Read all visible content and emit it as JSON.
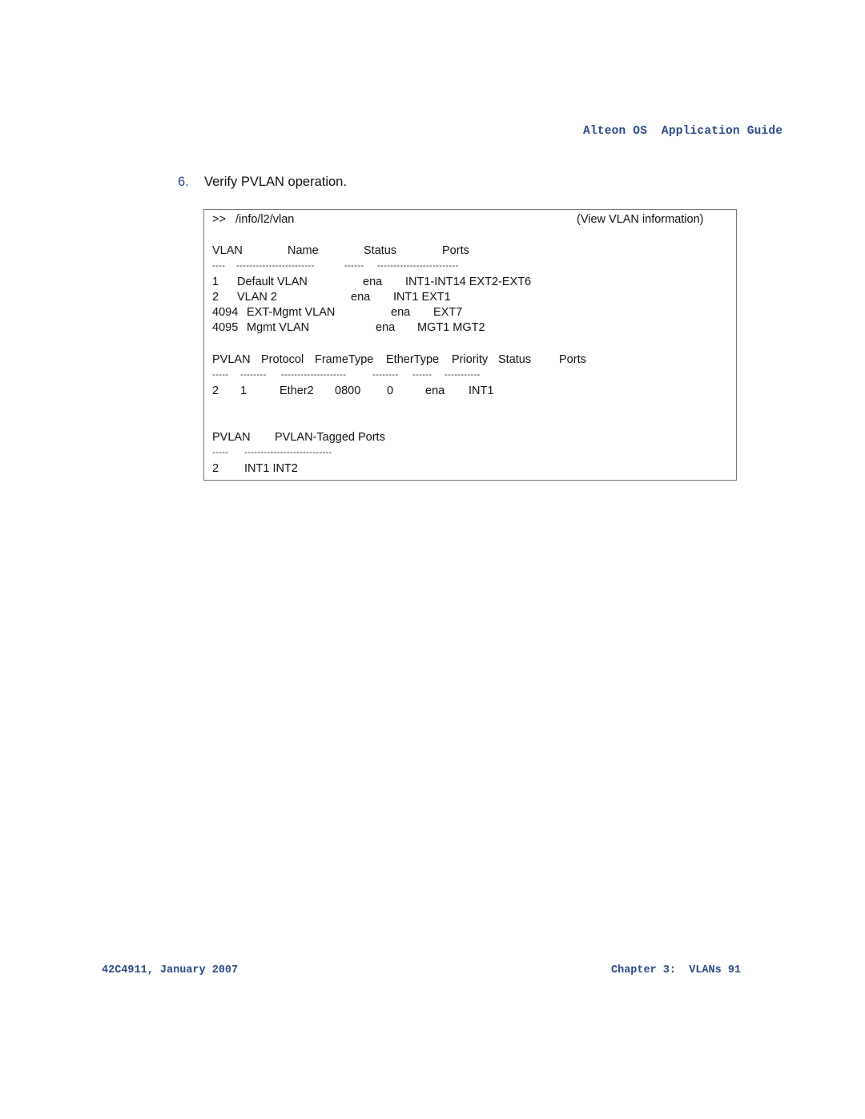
{
  "header": {
    "title": "Alteon OS  Application Guide"
  },
  "step": {
    "number": "6.",
    "text": "Verify PVLAN operation."
  },
  "command_box": {
    "prompt": ">>",
    "command": "/info/l2/vlan",
    "comment": "(View VLAN information)",
    "vlan_table": {
      "headers": [
        "VLAN",
        "Name",
        "Status",
        "Ports"
      ],
      "separator": [
        "----",
        "------------------------",
        "------",
        "-------------------------"
      ],
      "rows": [
        {
          "vlan": "1",
          "name": "Default VLAN",
          "status": "ena",
          "ports": "INT1-INT14 EXT2-EXT6"
        },
        {
          "vlan": "2",
          "name": "VLAN 2",
          "status": "ena",
          "ports": "INT1 EXT1"
        },
        {
          "vlan": "4094",
          "name": "EXT-Mgmt VLAN",
          "status": "ena",
          "ports": "EXT7"
        },
        {
          "vlan": "4095",
          "name": "Mgmt VLAN",
          "status": "ena",
          "ports": "MGT1 MGT2"
        }
      ]
    },
    "pvlan_table": {
      "headers": [
        "PVLAN",
        "Protocol",
        "FrameType",
        "EtherType",
        "Priority",
        "Status",
        "Ports"
      ],
      "separator": [
        "-----",
        "--------",
        "--------------------",
        "--------",
        "------",
        "-----------"
      ],
      "rows": [
        {
          "pvlan": "2",
          "protocol": "1",
          "frametype": "Ether2",
          "ethertype": "0800",
          "priority": "0",
          "status": "ena",
          "ports": "INT1"
        }
      ]
    },
    "tagged_table": {
      "headers": [
        "PVLAN",
        "PVLAN-Tagged Ports"
      ],
      "separator": [
        "-----",
        "---------------------------"
      ],
      "rows": [
        {
          "pvlan": "2",
          "ports": "INT1 INT2"
        }
      ]
    }
  },
  "footer": {
    "left": "42C4911, January 2007",
    "right": "Chapter 3:  VLANs 91"
  },
  "colors": {
    "accent": "#2a4a86",
    "text": "#111111",
    "border": "#777777"
  }
}
